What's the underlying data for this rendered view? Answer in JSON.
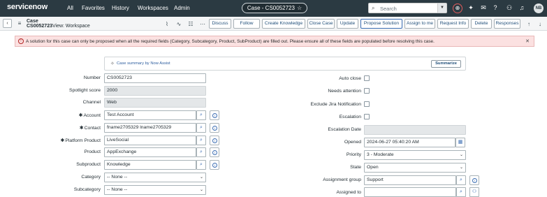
{
  "topnav": {
    "logo": "servicenow",
    "links": [
      "All",
      "Favorites",
      "History",
      "Workspaces",
      "Admin"
    ],
    "record_pill": "Case - CS0052723",
    "search_placeholder": "Search",
    "user_initials": "NB"
  },
  "header": {
    "record_type": "Case",
    "record_number": "CS0052723",
    "view": "View: Workspace",
    "buttons": [
      "Discuss",
      "Follow",
      "Create Knowledge",
      "Close Case",
      "Update",
      "Propose Solution",
      "Assign to me",
      "Request Info",
      "Delete",
      "Responses"
    ]
  },
  "alert": {
    "text": "A solution for this case can only be proposed when all the required fields (Category, Subcategory, Product, SubProduct) are filled out. Please ensure all of these fields are populated before resolving this case."
  },
  "assist": {
    "label": "Case summary by Now Assist",
    "button": "Summarize"
  },
  "form_left": {
    "number": {
      "label": "Number",
      "value": "CS0052723"
    },
    "spotlight": {
      "label": "Spotlight score",
      "value": "2000"
    },
    "channel": {
      "label": "Channel",
      "value": "Web"
    },
    "account": {
      "label": "Account",
      "value": "Test Account"
    },
    "contact": {
      "label": "Contact",
      "value": "fname2705329 lname2705329"
    },
    "platform_product": {
      "label": "Platform Product",
      "value": "LiveSocial"
    },
    "product": {
      "label": "Product",
      "value": "AppExchange"
    },
    "subproduct": {
      "label": "Subproduct",
      "value": "Knowledge"
    },
    "category": {
      "label": "Category",
      "value": "-- None --"
    },
    "subcategory": {
      "label": "Subcategory",
      "value": "-- None --"
    }
  },
  "form_right": {
    "auto_close": {
      "label": "Auto close"
    },
    "needs_attention": {
      "label": "Needs attention"
    },
    "exclude_jira": {
      "label": "Exclude Jira Notification"
    },
    "escalation": {
      "label": "Escalation"
    },
    "escalation_date": {
      "label": "Escalation Date",
      "value": ""
    },
    "opened": {
      "label": "Opened",
      "value": "2024-06-27 05:40:20 AM"
    },
    "priority": {
      "label": "Priority",
      "value": "3 - Moderate"
    },
    "state": {
      "label": "State",
      "value": "Open"
    },
    "assignment_group": {
      "label": "Assignment group",
      "value": "Support"
    },
    "assigned_to": {
      "label": "Assigned to",
      "value": ""
    }
  }
}
